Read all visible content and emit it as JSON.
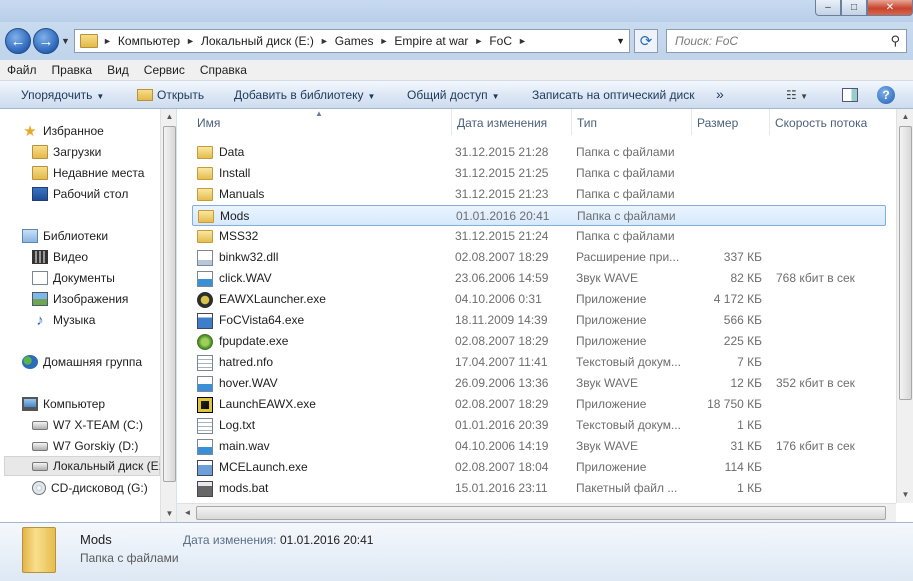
{
  "window": {
    "minimize": "–",
    "maximize": "□",
    "close": "✕"
  },
  "address": {
    "breadcrumbs": [
      "Компьютер",
      "Локальный диск (E:)",
      "Games",
      "Empire at war",
      "FoC"
    ],
    "search_placeholder": "Поиск: FoC"
  },
  "menu": [
    "Файл",
    "Правка",
    "Вид",
    "Сервис",
    "Справка"
  ],
  "toolbar": {
    "organize": "Упорядочить",
    "open": "Открыть",
    "add_to_library": "Добавить в библиотеку",
    "share": "Общий доступ",
    "burn": "Записать на оптический диск",
    "more": "»"
  },
  "nav": {
    "favorites": "Избранное",
    "downloads": "Загрузки",
    "recent": "Недавние места",
    "desktop": "Рабочий стол",
    "libraries": "Библиотеки",
    "video": "Видео",
    "documents": "Документы",
    "images": "Изображения",
    "music": "Музыка",
    "homegroup": "Домашняя группа",
    "computer": "Компьютер",
    "drive_c": "W7 X-TEAM (C:)",
    "drive_d": "W7 Gorskiy (D:)",
    "drive_e": "Локальный диск (E:)",
    "drive_g": "CD-дисковод (G:)"
  },
  "columns": {
    "name": "Имя",
    "date": "Дата изменения",
    "type": "Тип",
    "size": "Размер",
    "rate": "Скорость потока"
  },
  "files": [
    {
      "name": "Data",
      "date": "31.12.2015 21:28",
      "type": "Папка с файлами",
      "size": "",
      "rate": "",
      "icon": "folder"
    },
    {
      "name": "Install",
      "date": "31.12.2015 21:25",
      "type": "Папка с файлами",
      "size": "",
      "rate": "",
      "icon": "folder"
    },
    {
      "name": "Manuals",
      "date": "31.12.2015 21:23",
      "type": "Папка с файлами",
      "size": "",
      "rate": "",
      "icon": "folder"
    },
    {
      "name": "Mods",
      "date": "01.01.2016 20:41",
      "type": "Папка с файлами",
      "size": "",
      "rate": "",
      "icon": "folder",
      "selected": true
    },
    {
      "name": "MSS32",
      "date": "31.12.2015 21:24",
      "type": "Папка с файлами",
      "size": "",
      "rate": "",
      "icon": "folder"
    },
    {
      "name": "binkw32.dll",
      "date": "02.08.2007 18:29",
      "type": "Расширение при...",
      "size": "337 КБ",
      "rate": "",
      "icon": "dll"
    },
    {
      "name": "click.WAV",
      "date": "23.06.2006 14:59",
      "type": "Звук WAVE",
      "size": "82 КБ",
      "rate": "768 кбит в сек",
      "icon": "wav"
    },
    {
      "name": "EAWXLauncher.exe",
      "date": "04.10.2006 0:31",
      "type": "Приложение",
      "size": "4 172 КБ",
      "rate": "",
      "icon": "eaw"
    },
    {
      "name": "FoCVista64.exe",
      "date": "18.11.2009 14:39",
      "type": "Приложение",
      "size": "566 КБ",
      "rate": "",
      "icon": "win"
    },
    {
      "name": "fpupdate.exe",
      "date": "02.08.2007 18:29",
      "type": "Приложение",
      "size": "225 КБ",
      "rate": "",
      "icon": "fpu"
    },
    {
      "name": "hatred.nfo",
      "date": "17.04.2007 11:41",
      "type": "Текстовый докум...",
      "size": "7 КБ",
      "rate": "",
      "icon": "txt"
    },
    {
      "name": "hover.WAV",
      "date": "26.09.2006 13:36",
      "type": "Звук WAVE",
      "size": "12 КБ",
      "rate": "352 кбит в сек",
      "icon": "wav"
    },
    {
      "name": "LaunchEAWX.exe",
      "date": "02.08.2007 18:29",
      "type": "Приложение",
      "size": "18 750 КБ",
      "rate": "",
      "icon": "launch"
    },
    {
      "name": "Log.txt",
      "date": "01.01.2016 20:39",
      "type": "Текстовый докум...",
      "size": "1 КБ",
      "rate": "",
      "icon": "txt"
    },
    {
      "name": "main.wav",
      "date": "04.10.2006 14:19",
      "type": "Звук WAVE",
      "size": "31 КБ",
      "rate": "176 кбит в сек",
      "icon": "wav"
    },
    {
      "name": "MCELaunch.exe",
      "date": "02.08.2007 18:04",
      "type": "Приложение",
      "size": "114 КБ",
      "rate": "",
      "icon": "exe"
    },
    {
      "name": "mods.bat",
      "date": "15.01.2016 23:11",
      "type": "Пакетный файл ...",
      "size": "1 КБ",
      "rate": "",
      "icon": "bat"
    }
  ],
  "details": {
    "name": "Mods",
    "type": "Папка с файлами",
    "date_label": "Дата изменения:",
    "date_value": "01.01.2016 20:41"
  }
}
